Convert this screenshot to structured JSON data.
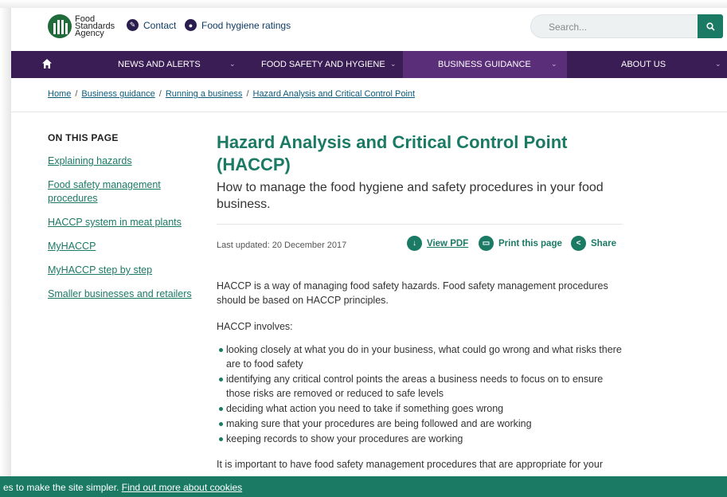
{
  "header": {
    "logo_lines": [
      "Food",
      "Standards",
      "Agency"
    ],
    "contact_label": "Contact",
    "ratings_label": "Food hygiene ratings",
    "search_placeholder": "Search..."
  },
  "nav": {
    "items": [
      {
        "label": "NEWS AND ALERTS"
      },
      {
        "label": "FOOD SAFETY AND HYGIENE"
      },
      {
        "label": "BUSINESS GUIDANCE"
      },
      {
        "label": "ABOUT US"
      }
    ],
    "active_index": 2
  },
  "breadcrumb": [
    "Home",
    "Business guidance",
    "Running a business",
    "Hazard Analysis and Critical Control Point"
  ],
  "sidebar": {
    "title": "ON THIS PAGE",
    "links": [
      "Explaining hazards",
      "Food safety management procedures",
      "HACCP system in meat plants",
      "MyHACCP",
      "MyHACCP step by step",
      "Smaller businesses and retailers"
    ]
  },
  "article": {
    "title": "Hazard Analysis and Critical Control Point (HACCP)",
    "subtitle": "How to manage the food hygiene and safety procedures in your food business.",
    "last_updated": "Last updated: 20 December 2017",
    "view_pdf": "View PDF",
    "print": "Print this page",
    "share": "Share",
    "intro": "HACCP is a way of managing food safety hazards. Food safety management procedures should be based on HACCP principles.",
    "involves": "HACCP involves:",
    "bullets": [
      "looking closely at what you do in your business, what could go wrong and what risks there are to food safety",
      "identifying any critical control points the areas a business needs to focus on to ensure those risks are removed or reduced to safe levels",
      "deciding what action you need to take if something goes wrong",
      "making sure that your procedures are being followed and are working",
      "keeping records to show your procedures are working"
    ],
    "closing": "It is important to have food safety management procedures that are appropriate for your"
  },
  "cookie": {
    "text": "es to make the site simpler.",
    "link": "Find out more about cookies"
  },
  "colors": {
    "brand_green": "#1b7a64",
    "nav_purple": "#3b1d55",
    "nav_active": "#5b2e7a"
  }
}
